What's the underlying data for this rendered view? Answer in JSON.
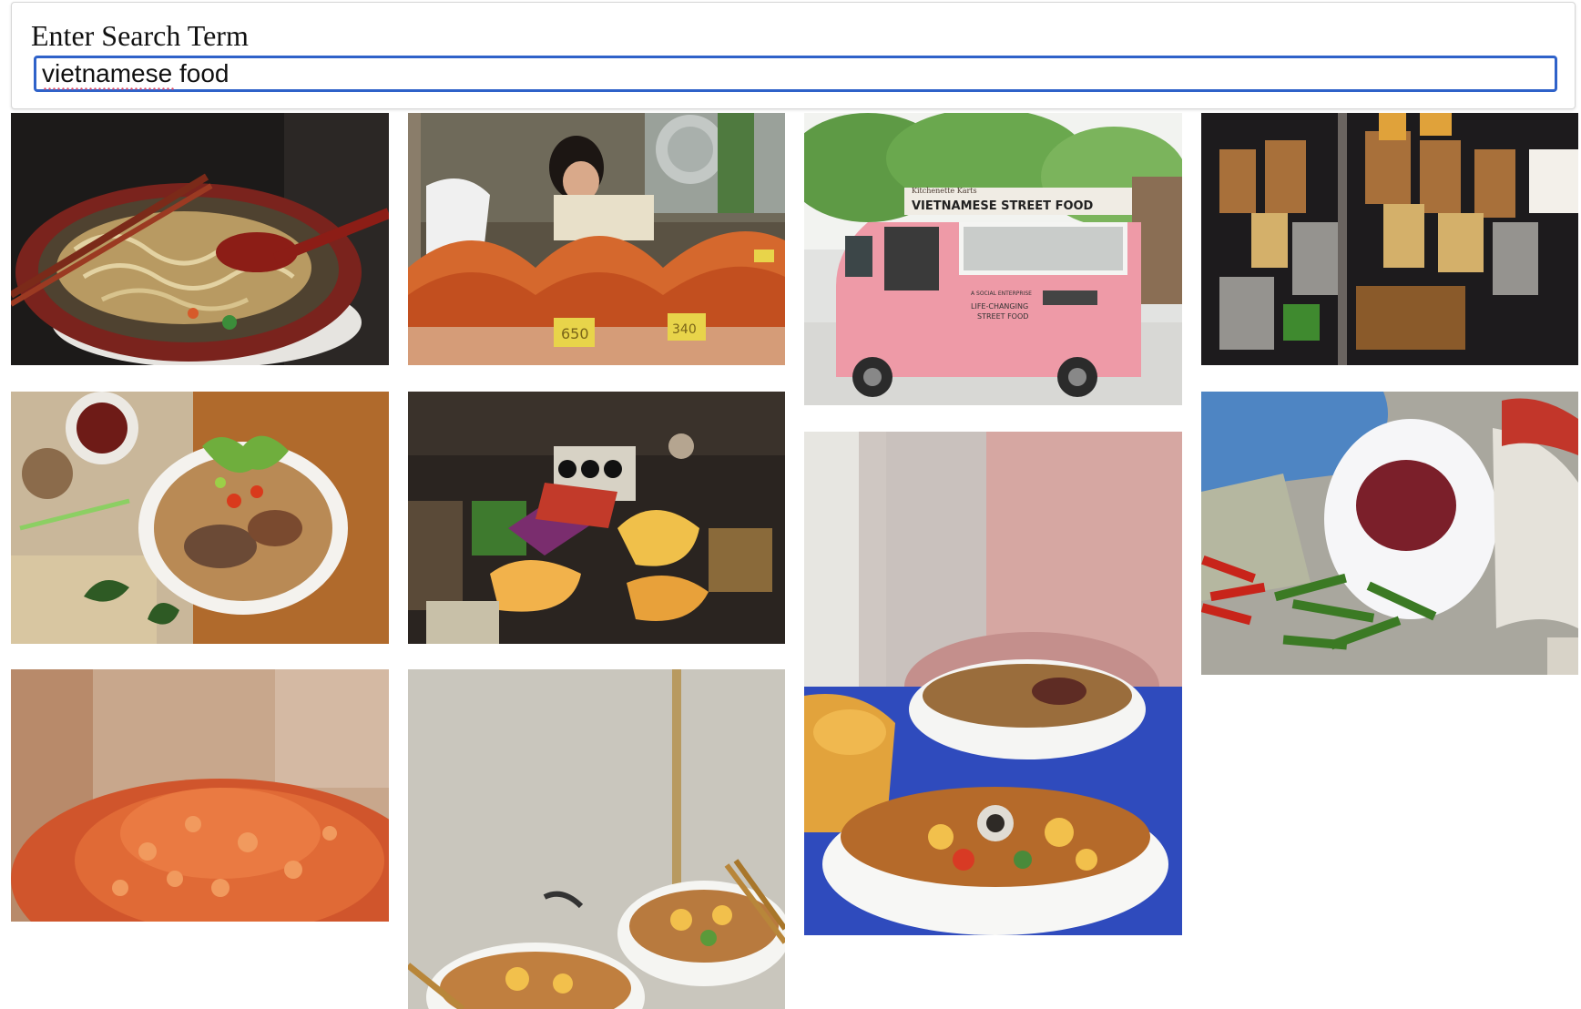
{
  "search": {
    "label": "Enter Search Term",
    "value": "vietnamese food"
  },
  "photos": [
    {
      "icon": "noodle-soup-bowl-image"
    },
    {
      "icon": "market-dried-shrimp-vendor-image"
    },
    {
      "icon": "pink-food-truck-image",
      "sign": "VIETNAMESE STREET FOOD",
      "brand": "Kitchenette Karts",
      "side_text_1": "A SOCIAL ENTERPRISE",
      "side_text_2": "LIFE-CHANGING",
      "side_text_3": "STREET FOOD"
    },
    {
      "icon": "hanging-snack-bags-image"
    },
    {
      "icon": "pho-with-herbs-image"
    },
    {
      "icon": "market-snacks-pile-image"
    },
    {
      "icon": "noodle-soup-table-image"
    },
    {
      "icon": "spices-and-chilies-image"
    },
    {
      "icon": "dried-shrimp-pile-image"
    },
    {
      "icon": "noodle-bowls-wall-image"
    }
  ],
  "market_tags": [
    "650",
    "340"
  ]
}
